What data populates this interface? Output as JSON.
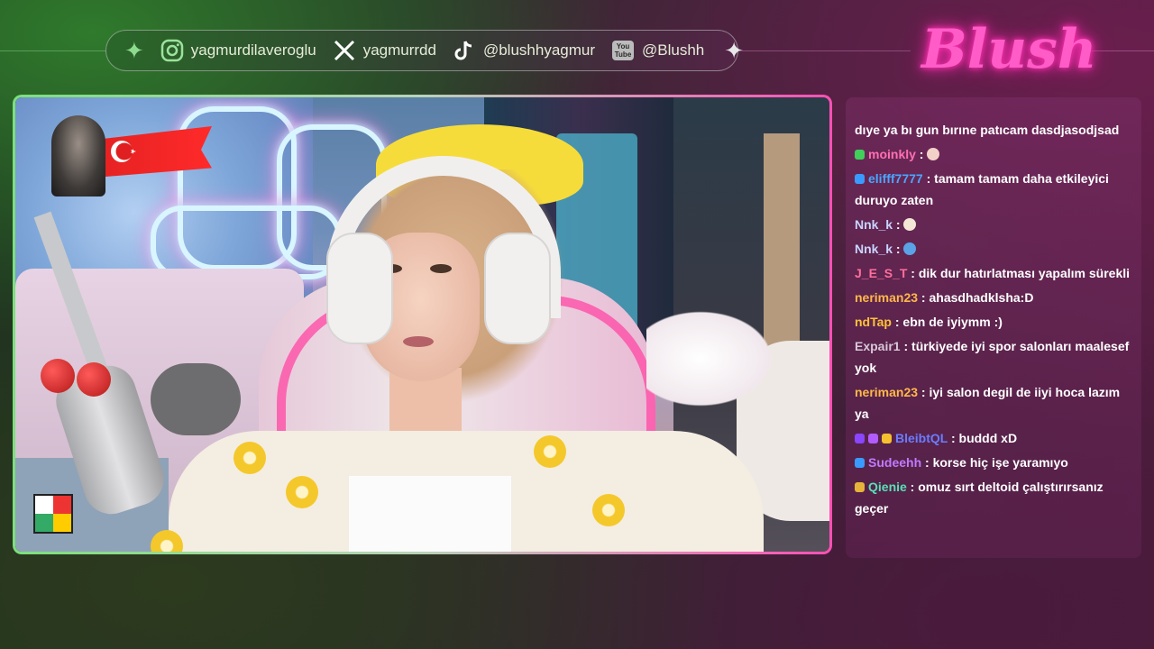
{
  "colors": {
    "accent_green": "#7ce07c",
    "accent_pink": "#ff4fb5",
    "chat_bg": "#6f2a5d"
  },
  "logo": {
    "text": "Blush"
  },
  "socials": [
    {
      "icon": "instagram-icon",
      "handle": "yagmurdilaveroglu"
    },
    {
      "icon": "x-icon",
      "handle": "yagmurrdd"
    },
    {
      "icon": "tiktok-icon",
      "handle": "@blushhyagmur"
    },
    {
      "icon": "youtube-icon",
      "handle": "@Blushh",
      "icon_text_top": "You",
      "icon_text_bottom": "Tube"
    }
  ],
  "chat": {
    "messages": [
      {
        "user": "",
        "user_color": "#ffffff",
        "badges": [],
        "text": "dıye ya bı gun bırıne patıcam dasdjasodjsad"
      },
      {
        "user": "moinkly",
        "user_color": "#ff6fb3",
        "badges": [
          "green-check-badge"
        ],
        "text": "",
        "emote": "face-emote"
      },
      {
        "user": "elifff7777",
        "user_color": "#4aa6ff",
        "badges": [
          "blue-cube-badge"
        ],
        "text": "tamam tamam daha etkileyici duruyo zaten"
      },
      {
        "user": "Nnk_k",
        "user_color": "#c9d4ff",
        "badges": [],
        "text": "",
        "emote": "duck-emote"
      },
      {
        "user": "Nnk_k",
        "user_color": "#c9d4ff",
        "badges": [],
        "text": "",
        "emote": "eye-emote"
      },
      {
        "user": "J_E_S_T",
        "user_color": "#ff6f9a",
        "badges": [],
        "text": "dik dur hatırlatması yapalım sürekli"
      },
      {
        "user": "neriman23",
        "user_color": "#ffb84a",
        "badges": [],
        "text": "ahasdhadklsha:D"
      },
      {
        "user": "ndTap",
        "user_color": "#ffc23a",
        "badges": [],
        "text": "ebn de iyiymm :)"
      },
      {
        "user": "Expair1",
        "user_color": "#d8c8d8",
        "badges": [],
        "text": "türkiyede iyi spor salonları maalesef yok"
      },
      {
        "user": "neriman23",
        "user_color": "#ffb84a",
        "badges": [],
        "text": "iyi salon degil de iiyi hoca lazım ya"
      },
      {
        "user": "BleibtQL",
        "user_color": "#6b7cff",
        "badges": [
          "purple-cube-badge",
          "purple-shield-badge",
          "gold-crown-badge"
        ],
        "text": "buddd xD"
      },
      {
        "user": "Sudeehh",
        "user_color": "#c07aff",
        "badges": [
          "blue-cube-badge"
        ],
        "text": "korse hiç işe yaramıyo"
      },
      {
        "user": "Qienie",
        "user_color": "#57e0b5",
        "badges": [
          "gold-ring-badge"
        ],
        "text": "omuz sırt deltoid çalıştırırsanız geçer"
      }
    ]
  }
}
